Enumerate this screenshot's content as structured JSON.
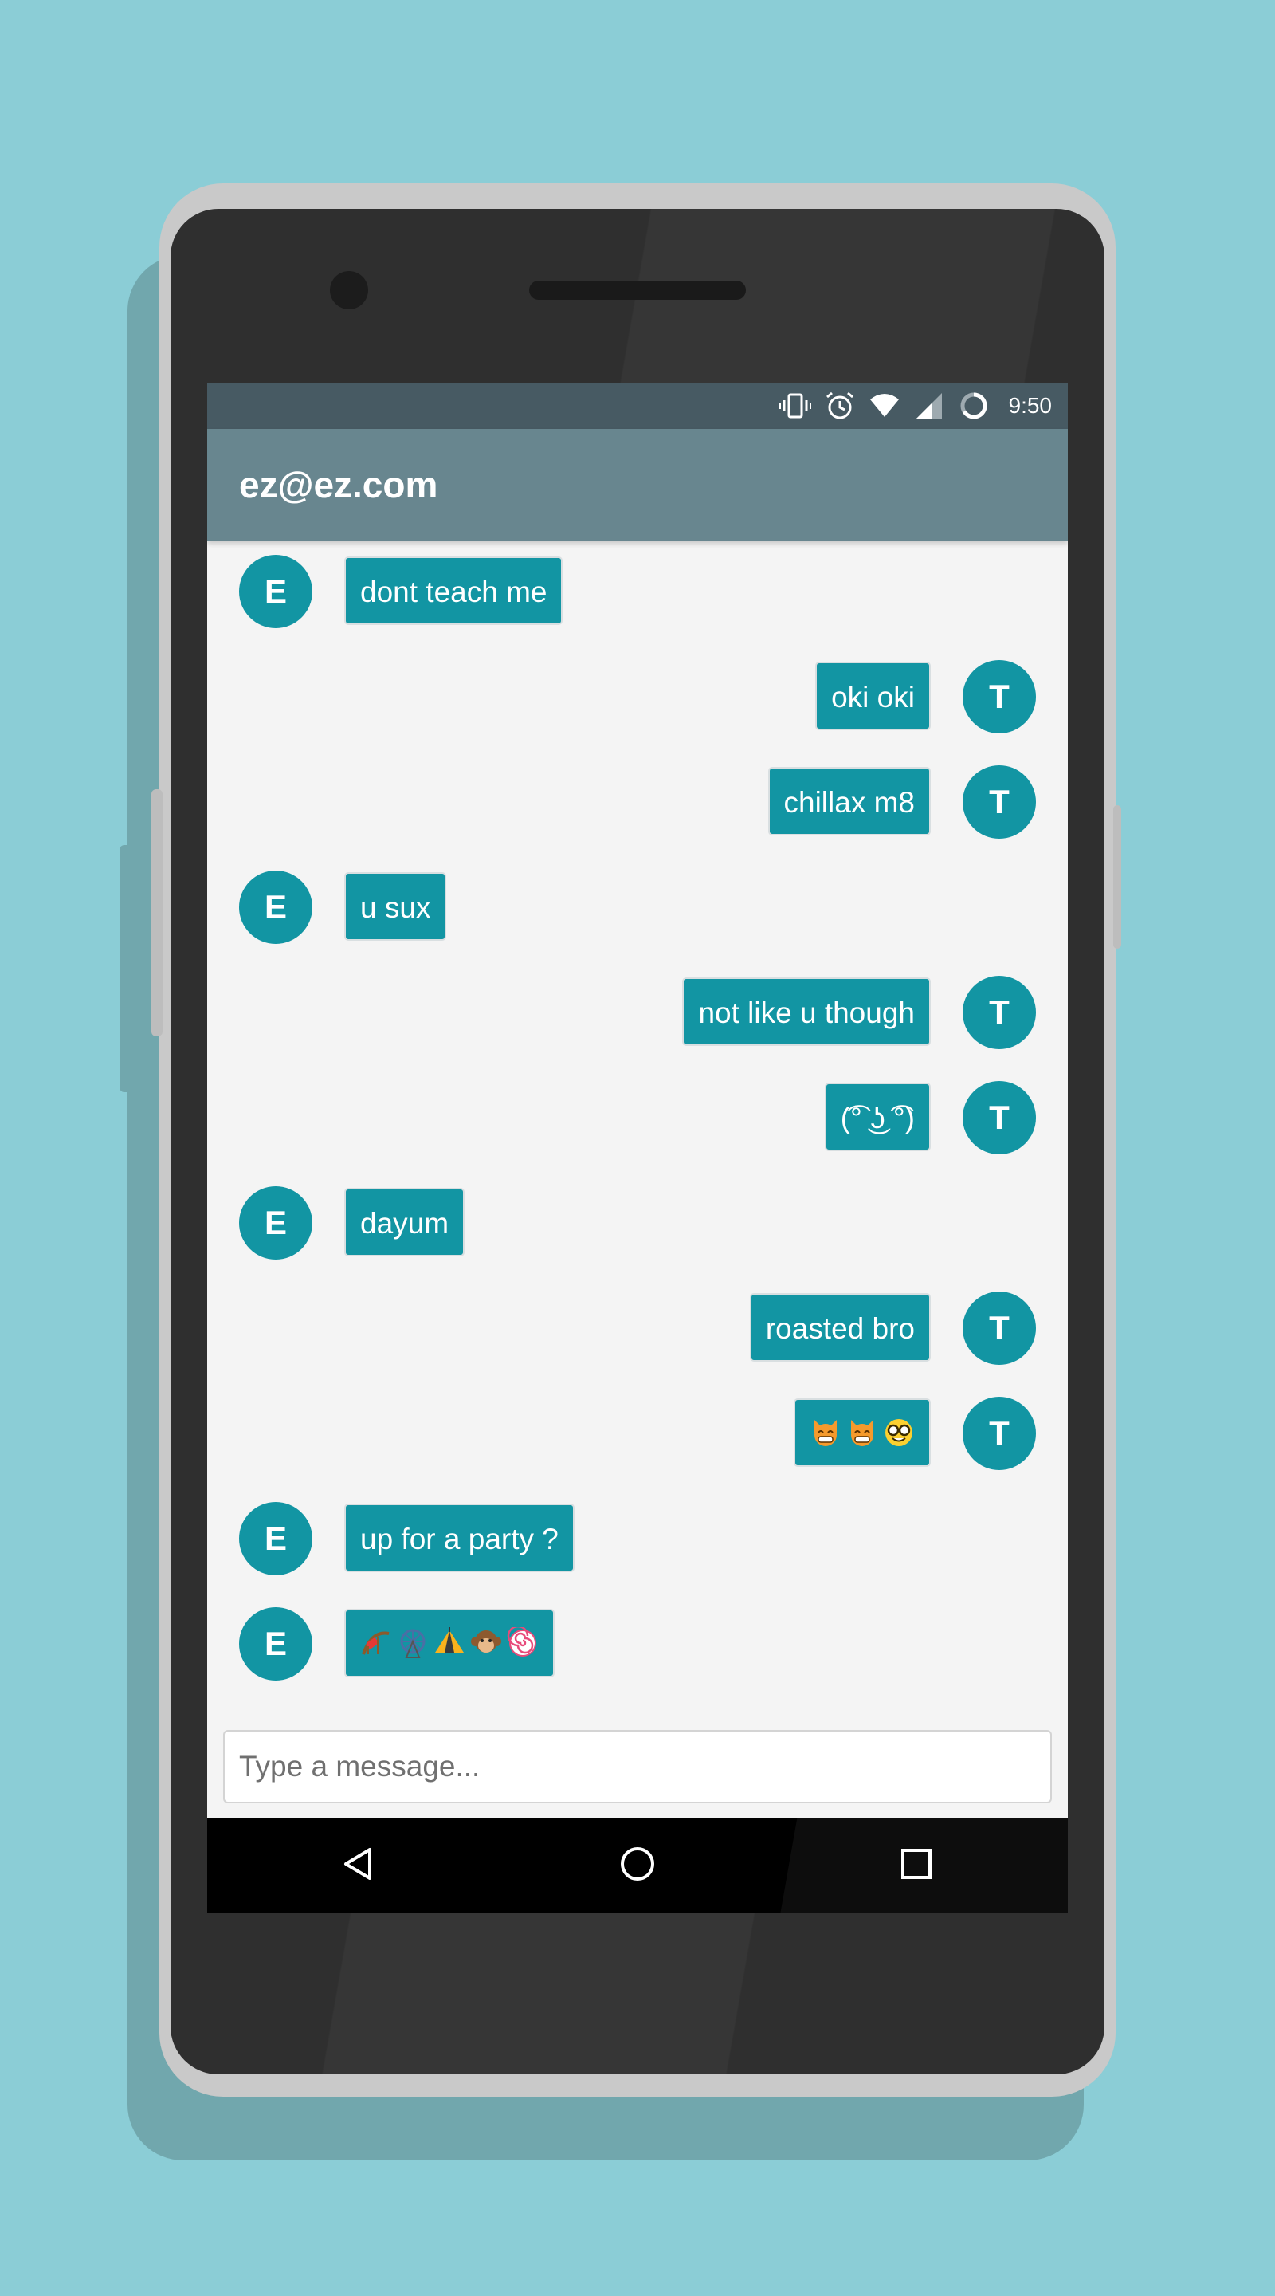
{
  "status_bar": {
    "time": "9:50",
    "icons": [
      "vibrate-icon",
      "alarm-icon",
      "wifi-icon",
      "cell-signal-icon",
      "loading-spinner-icon"
    ]
  },
  "app_bar": {
    "title": "ez@ez.com"
  },
  "messages": [
    {
      "side": "left",
      "avatar": "E",
      "text": "dont teach me"
    },
    {
      "side": "right",
      "avatar": "T",
      "text": "oki oki"
    },
    {
      "side": "right",
      "avatar": "T",
      "text": "chillax m8"
    },
    {
      "side": "left",
      "avatar": "E",
      "text": "u sux"
    },
    {
      "side": "right",
      "avatar": "T",
      "text": "not like u though"
    },
    {
      "side": "right",
      "avatar": "T",
      "text": "(͡° ͜ʖ ͡°)"
    },
    {
      "side": "left",
      "avatar": "E",
      "text": "dayum"
    },
    {
      "side": "right",
      "avatar": "T",
      "text": "roasted bro"
    },
    {
      "side": "right",
      "avatar": "T",
      "emojis": [
        "grinning-cat-emoji",
        "grinning-cat-emoji",
        "nerd-face-emoji"
      ]
    },
    {
      "side": "left",
      "avatar": "E",
      "text": "up for a party ?"
    },
    {
      "side": "left",
      "avatar": "E",
      "emojis": [
        "roller-coaster-emoji",
        "ferris-wheel-emoji",
        "circus-tent-emoji",
        "monkey-emoji",
        "lollipop-emoji"
      ]
    }
  ],
  "composer": {
    "placeholder": "Type a message..."
  },
  "nav": {
    "icons": [
      "back-icon",
      "home-icon",
      "recents-icon"
    ]
  },
  "colors": {
    "background": "#8bcdd6",
    "status_bar": "#475a63",
    "app_bar": "#68868f",
    "bubble": "#1295a3",
    "avatar": "#1295a3",
    "chat_background": "#f4f4f4"
  }
}
